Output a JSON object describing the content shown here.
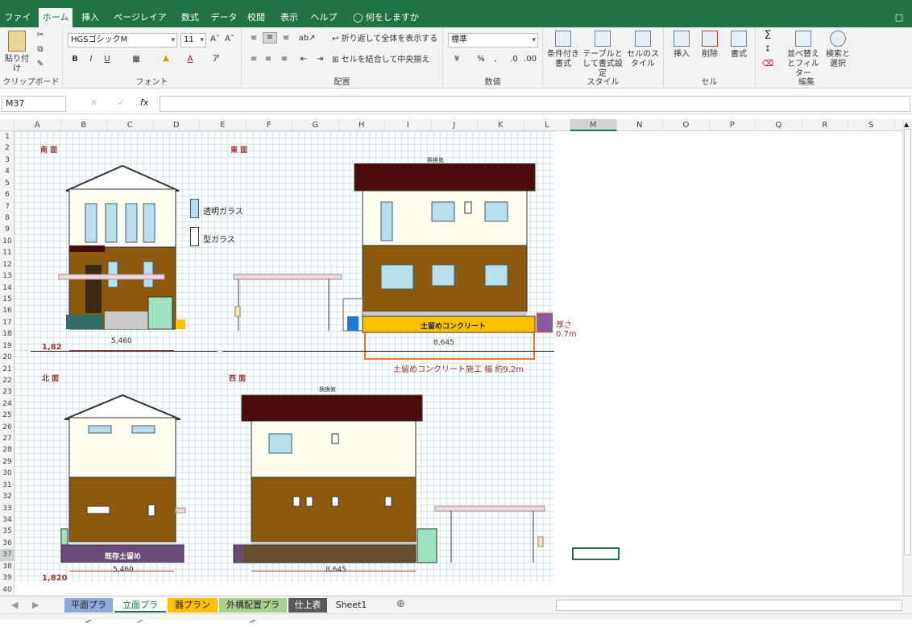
{
  "ribbon_tabs": [
    "ファイル",
    "ホーム",
    "挿入",
    "ページレイアウト",
    "数式",
    "データ",
    "校閲",
    "表示",
    "ヘルプ",
    "何をしますか"
  ],
  "ribbon": {
    "clipboard": {
      "paste": "貼り付け",
      "label": "クリップボード"
    },
    "font": {
      "name": "HGSゴシックM",
      "size": "11",
      "label": "フォント"
    },
    "alignment": {
      "wrap": "折り返して全体を表示する",
      "merge": "セルを結合して中央揃え",
      "label": "配置"
    },
    "number": {
      "format": "標準",
      "label": "数値"
    },
    "styles": {
      "conditional": "条件付き書式",
      "table": "テーブルとして書式設定",
      "cell_styles": "セルのスタイル",
      "label": "スタイル"
    },
    "cells": {
      "insert": "挿入",
      "delete": "削除",
      "format": "書式",
      "label": "セル"
    },
    "editing": {
      "sort": "並べ替えとフィルター",
      "find": "検索と選択",
      "label": "編集"
    }
  },
  "formula_bar": {
    "name_box": "M37",
    "fx": "fx",
    "value": ""
  },
  "columns": [
    "A",
    "B",
    "C",
    "D",
    "E",
    "F",
    "G",
    "H",
    "I",
    "J",
    "K",
    "L",
    "M",
    "N",
    "O",
    "P",
    "Q",
    "R",
    "S"
  ],
  "selected_column": "M",
  "selected_row": "37",
  "rows": [
    "1",
    "2",
    "3",
    "4",
    "5",
    "6",
    "7",
    "8",
    "9",
    "10",
    "11",
    "12",
    "13",
    "14",
    "15",
    "16",
    "17",
    "18",
    "19",
    "20",
    "21",
    "22",
    "23",
    "24",
    "25",
    "26",
    "27",
    "28",
    "29",
    "30",
    "31",
    "32",
    "33",
    "34",
    "35",
    "36",
    "37",
    "38",
    "39",
    "40"
  ],
  "drawing": {
    "south_title": "南 面",
    "east_title": "東 面",
    "north_title": "北 面",
    "west_title": "西 面",
    "legend_clear": "透明ガラス",
    "legend_frosted": "型ガラス",
    "vent_label_top": "換換気",
    "vent_label_bottom": "換換気",
    "concrete_label": "土留めコンクリート",
    "thickness_note": "厚さ 0.7m",
    "dim_south": "5,460",
    "dim_east": "8,645",
    "note_concrete_width": "土留めコンクリート施工 幅 約9.2m",
    "height_top": "1,82",
    "existing_retaining": "既存土留め",
    "dim_north": "5,460",
    "dim_west": "8,645",
    "height_bottom": "1,820"
  },
  "sheet_tabs": [
    {
      "label": "平面プラン",
      "color": "#8ea9db"
    },
    {
      "label": "立面プラン",
      "color": "#ffffff"
    },
    {
      "label": "器プラン",
      "color": "#ffc000"
    },
    {
      "label": "外構配置プラン",
      "color": "#a9d08e"
    },
    {
      "label": "仕上表",
      "color": "#595959"
    },
    {
      "label": "Sheet1",
      "color": "#f3f3f3"
    }
  ],
  "colors": {
    "excel_green": "#217346",
    "brown": "#8b5a0c",
    "dark_roof": "#4a0b0b",
    "cream": "#fffdf0",
    "concrete_yellow": "#ffc000",
    "orange": "#e5762d",
    "red_text": "#a3342a"
  }
}
